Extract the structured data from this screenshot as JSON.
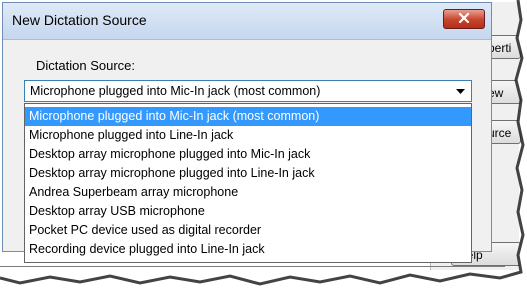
{
  "dialog": {
    "title": "New Dictation Source",
    "close_icon": "close-icon",
    "source_label": "Dictation Source:",
    "selected_value": "Microphone plugged into Mic-In jack (most common)",
    "options": [
      "Microphone plugged into Mic-In jack (most common)",
      "Microphone plugged into Line-In jack",
      "Desktop array microphone plugged into Mic-In jack",
      "Desktop array microphone plugged into Line-In jack",
      "Andrea Superbeam array microphone",
      "Desktop array USB microphone",
      "Pocket PC device used as digital recorder",
      "Recording device plugged into Line-In jack"
    ],
    "highlighted_index": 0
  },
  "background_window": {
    "buttons": [
      "perti",
      "ew",
      "urce",
      "Help"
    ]
  },
  "colors": {
    "selection": "#3399ff",
    "close_button": "#c8432c",
    "titlebar": "#c5d7ee"
  }
}
